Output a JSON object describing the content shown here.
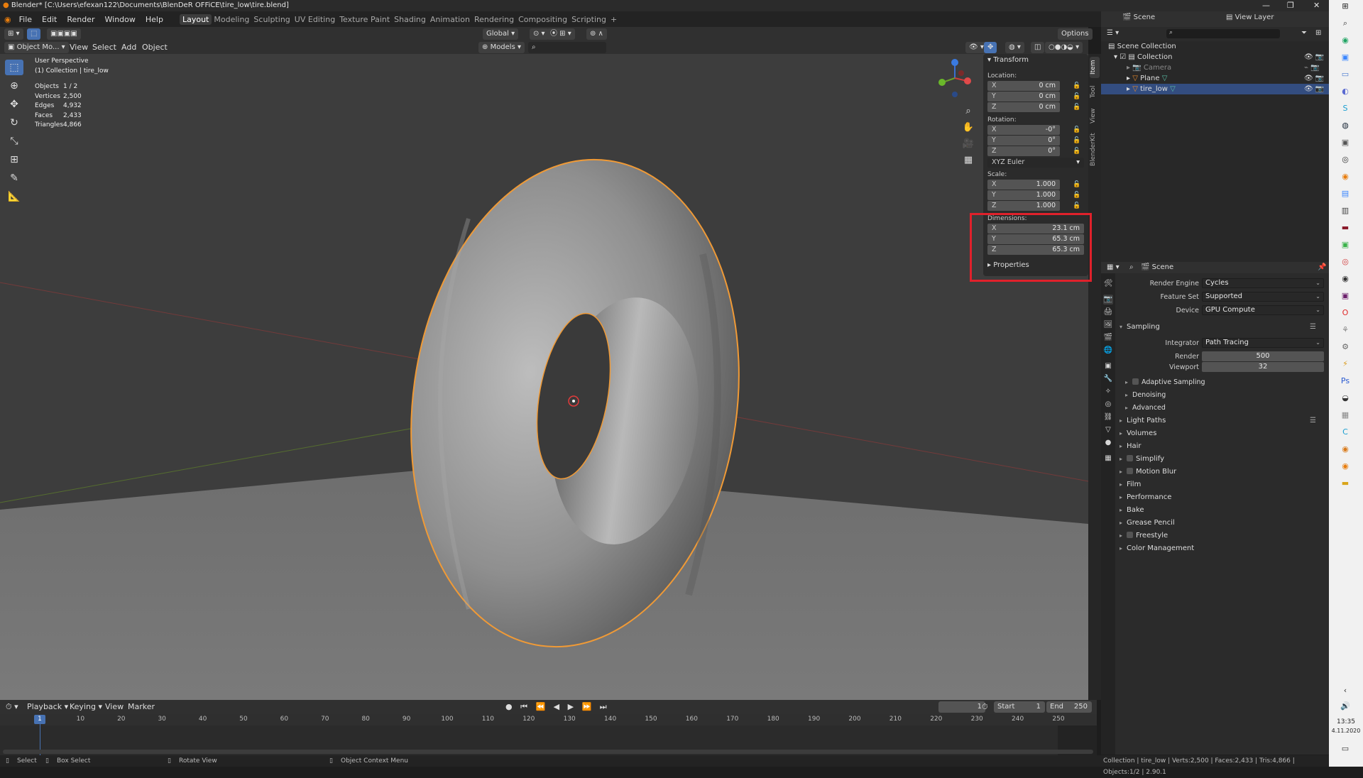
{
  "window": {
    "title": "Blender* [C:\\Users\\efexan122\\Documents\\BlenDeR OFFiCE\\tire_low\\tire.blend]"
  },
  "menu": {
    "items": [
      "File",
      "Edit",
      "Render",
      "Window",
      "Help"
    ]
  },
  "workspaces": [
    "Layout",
    "Modeling",
    "Sculpting",
    "UV Editing",
    "Texture Paint",
    "Shading",
    "Animation",
    "Rendering",
    "Compositing",
    "Scripting",
    "+"
  ],
  "viewport_header": {
    "mode": "Object Mo...",
    "menus": [
      "View",
      "Select",
      "Add",
      "Object"
    ],
    "orientation": "Global",
    "collection_filter": "Models",
    "options": "Options"
  },
  "overlay": {
    "view_name": "User Perspective",
    "collection": "(1) Collection | tire_low",
    "stats": [
      {
        "label": "Objects",
        "value": "1 / 2"
      },
      {
        "label": "Vertices",
        "value": "2,500"
      },
      {
        "label": "Edges",
        "value": "4,932"
      },
      {
        "label": "Faces",
        "value": "2,433"
      },
      {
        "label": "Triangles",
        "value": "4,866"
      }
    ]
  },
  "n_panel": {
    "section": "Transform",
    "location_label": "Location:",
    "location": [
      {
        "axis": "X",
        "value": "0 cm"
      },
      {
        "axis": "Y",
        "value": "0 cm"
      },
      {
        "axis": "Z",
        "value": "0 cm"
      }
    ],
    "rotation_label": "Rotation:",
    "rotation": [
      {
        "axis": "X",
        "value": "-0°"
      },
      {
        "axis": "Y",
        "value": "0°"
      },
      {
        "axis": "Z",
        "value": "0°"
      }
    ],
    "rotation_mode": "XYZ Euler",
    "scale_label": "Scale:",
    "scale": [
      {
        "axis": "X",
        "value": "1.000"
      },
      {
        "axis": "Y",
        "value": "1.000"
      },
      {
        "axis": "Z",
        "value": "1.000"
      }
    ],
    "dimensions_label": "Dimensions:",
    "dimensions": [
      {
        "axis": "X",
        "value": "23.1 cm"
      },
      {
        "axis": "Y",
        "value": "65.3 cm"
      },
      {
        "axis": "Z",
        "value": "65.3 cm"
      }
    ],
    "properties_label": "Properties",
    "tabs": [
      "Item",
      "Tool",
      "View",
      "BlenderKit"
    ]
  },
  "outliner": {
    "scene": "Scene",
    "view_layer": "View Layer",
    "rows": [
      {
        "label": "Scene Collection",
        "indent": 0,
        "selected": false
      },
      {
        "label": "Collection",
        "indent": 1,
        "selected": false
      },
      {
        "label": "Camera",
        "indent": 2,
        "selected": false
      },
      {
        "label": "Plane",
        "indent": 2,
        "selected": false
      },
      {
        "label": "tire_low",
        "indent": 2,
        "selected": true
      }
    ]
  },
  "properties": {
    "context": "Scene",
    "render_engine_label": "Render Engine",
    "render_engine": "Cycles",
    "feature_set_label": "Feature Set",
    "feature_set": "Supported",
    "device_label": "Device",
    "device": "GPU Compute",
    "sampling_label": "Sampling",
    "integrator_label": "Integrator",
    "integrator": "Path Tracing",
    "render_label": "Render",
    "render_samples": "500",
    "viewport_label": "Viewport",
    "viewport_samples": "32",
    "sub_sections": [
      "Adaptive Sampling",
      "Denoising",
      "Advanced"
    ],
    "sections": [
      "Light Paths",
      "Volumes",
      "Hair",
      "Simplify",
      "Motion Blur",
      "Film",
      "Performance",
      "Bake",
      "Grease Pencil",
      "Freestyle",
      "Color Management"
    ]
  },
  "timeline": {
    "menus": [
      "Playback",
      "Keying",
      "View",
      "Marker"
    ],
    "current_frame": "1",
    "start_label": "Start",
    "start": "1",
    "end_label": "End",
    "end": "250",
    "ticks": [
      "10",
      "20",
      "30",
      "40",
      "50",
      "60",
      "70",
      "80",
      "90",
      "100",
      "110",
      "120",
      "130",
      "140",
      "150",
      "160",
      "170",
      "180",
      "190",
      "200",
      "210",
      "220",
      "230",
      "240",
      "250"
    ]
  },
  "statusbar": {
    "select": "Select",
    "box_select": "Box Select",
    "rotate_view": "Rotate View",
    "context_menu": "Object Context Menu",
    "info": "Collection | tire_low | Verts:2,500 | Faces:2,433 | Tris:4,866 | Objects:1/2 | 2.90.1"
  },
  "taskbar": {
    "time": "13:35",
    "date": "4.11.2020"
  }
}
